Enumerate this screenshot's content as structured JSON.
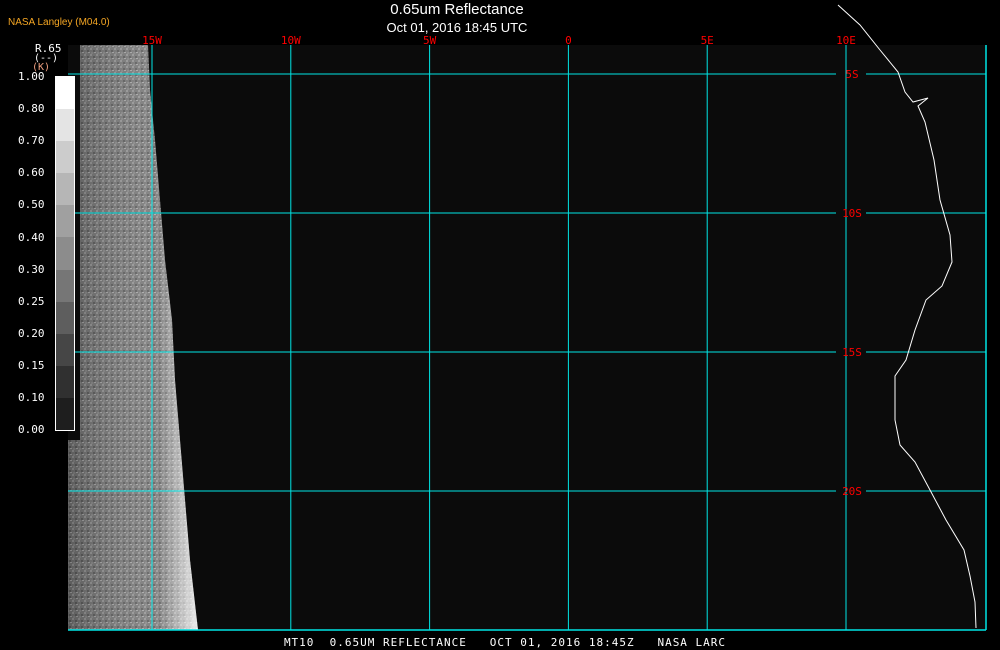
{
  "header": {
    "brand": "NASA Langley (M04.0)",
    "title": "0.65um Reflectance",
    "subtitle": "Oct 01, 2016 18:45 UTC"
  },
  "colorbar": {
    "variable": "R.65",
    "unit": "(--)",
    "unit_alt": "(K)",
    "labels": [
      "1.00",
      "0.80",
      "0.70",
      "0.60",
      "0.50",
      "0.40",
      "0.30",
      "0.25",
      "0.20",
      "0.15",
      "0.10",
      "0.00"
    ],
    "colors": [
      "#ffffff",
      "#e4e4e4",
      "#cccccc",
      "#b6b6b6",
      "#a0a0a0",
      "#8c8c8c",
      "#767676",
      "#5e5e5e",
      "#464646",
      "#303030",
      "#1e1e1e",
      "#0e0e0e"
    ]
  },
  "map": {
    "longitude_labels": [
      "15W",
      "10W",
      "5W",
      "0",
      "5E",
      "10E"
    ],
    "latitude_labels": [
      "5S",
      "10S",
      "15S",
      "20S"
    ],
    "grid_color": "#00e5e5",
    "label_color": "#ff0000",
    "ocean_color": "#0b0b0b",
    "coastline_color": "#ffffff"
  },
  "footer": {
    "text": "MT10  0.65UM REFLECTANCE   OCT 01, 2016 18:45Z   NASA LARC"
  }
}
